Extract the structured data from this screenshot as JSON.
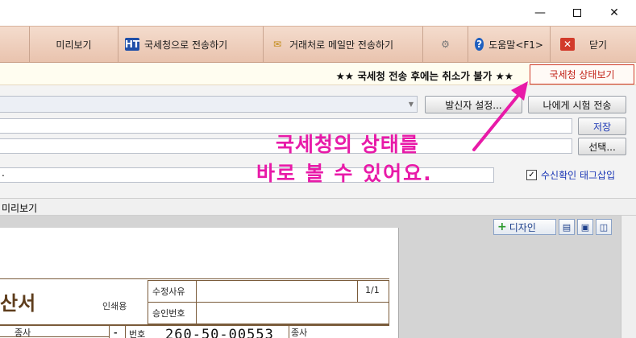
{
  "window": {
    "minimize": "—",
    "close": "✕"
  },
  "toolbar": {
    "preview": "미리보기",
    "send_nts": "국세청으로 전송하기",
    "mail_only": "거래처로 메일만 전송하기",
    "help": "도움말<F1>",
    "close": "닫기",
    "icons": {
      "send_nts": "hometax-icon",
      "mail_only": "envelope-icon",
      "settings": "gear-icon",
      "help": "help-icon",
      "close": "close-icon"
    }
  },
  "notice": {
    "warning": "★★ 국세청 전송 후에는 취소가 불가 ★★",
    "status_button": "국세청 상태보기"
  },
  "form": {
    "sender_settings": "발신자 설정...",
    "test_send": "나에게 시험 전송",
    "save": "저장",
    "select": "선택...",
    "field_value": ".",
    "receipt_tag_label": "수신확인 태그삽입",
    "receipt_tag_checked": true
  },
  "annotation": {
    "line1": "국세청의 상태를",
    "line2": "바로 볼 수 있어요.",
    "color": "#e81aa8"
  },
  "preview": {
    "header": "미리보기",
    "design_button": "디자인"
  },
  "document": {
    "title": "산서",
    "print_label": "인쇄용",
    "revision_reason": "수정사유",
    "approval_number": "승인번호",
    "page_indicator": "1/1",
    "business_label_left": "종사",
    "number_label": "번호",
    "registration_number": "260-50-00553",
    "business_label_right": "종사"
  }
}
